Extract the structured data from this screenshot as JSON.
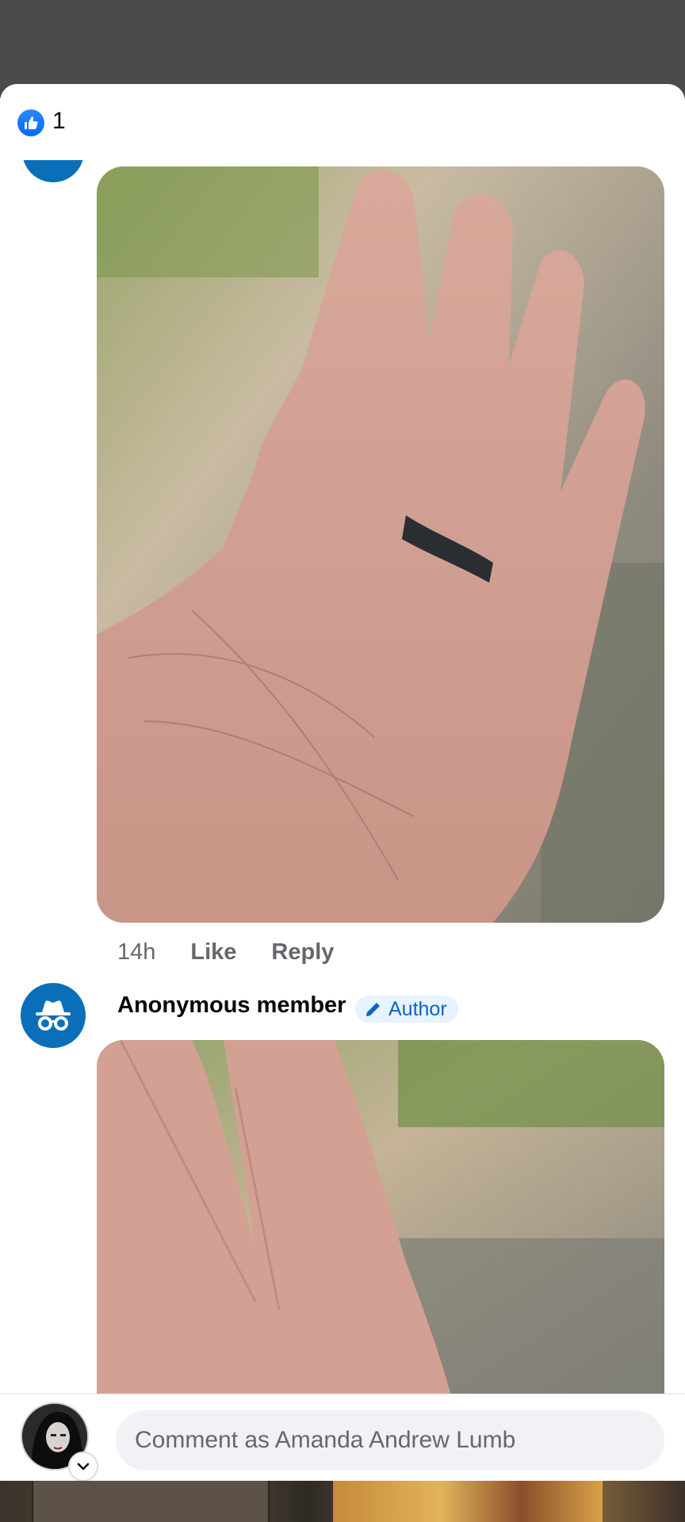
{
  "reactions": {
    "count": "1",
    "icon": "like-icon"
  },
  "comment1": {
    "time": "14h",
    "like_label": "Like",
    "reply_label": "Reply"
  },
  "comment2": {
    "author": "Anonymous member",
    "badge_label": "Author",
    "badge_icon": "pencil-icon",
    "avatar_icon": "incognito-icon"
  },
  "composer": {
    "placeholder": "Comment as Amanda Andrew Lumb",
    "chevron_icon": "chevron-down-icon"
  },
  "colors": {
    "brand_blue": "#0866ff",
    "anon_avatar": "#0a6fb8",
    "badge_bg": "#e7f3ff",
    "muted_text": "#65676b"
  }
}
